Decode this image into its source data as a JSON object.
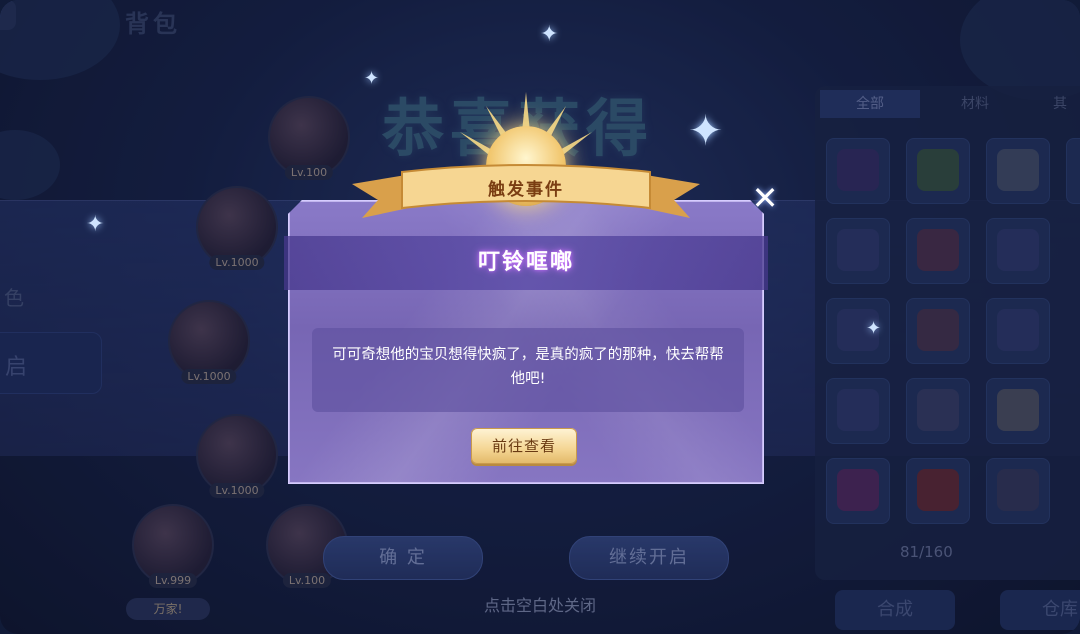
{
  "background": {
    "bag_title": "背包",
    "headline": "恭喜获得",
    "left_label": "色",
    "left_button": "启",
    "characters": [
      {
        "level": "Lv.100"
      },
      {
        "level": "Lv.1000"
      },
      {
        "level": "Lv.1000"
      },
      {
        "level": "Lv.1000"
      },
      {
        "level": "Lv.999"
      },
      {
        "level": "Lv.100"
      }
    ],
    "rank_pill": "万家!",
    "tabs": [
      "全部",
      "材料",
      "其"
    ],
    "capacity": "81/160",
    "bottom_buttons": [
      "合成",
      "仓库"
    ],
    "confirm_button": "确 定",
    "continue_button": "继续开启",
    "close_hint": "点击空白处关闭"
  },
  "dialog": {
    "ribbon_title": "触发事件",
    "event_name": "叮铃哐啷",
    "message": "可可奇想他的宝贝想得快疯了，是真的疯了的那种，快去帮帮他吧!",
    "go_button": "前往查看",
    "close_icon": "close-icon"
  },
  "colors": {
    "dialog_bg": "#7766b4",
    "gold": "#f1c56b",
    "subtitle_glow": "#d07bff",
    "background": "#1a2752"
  }
}
